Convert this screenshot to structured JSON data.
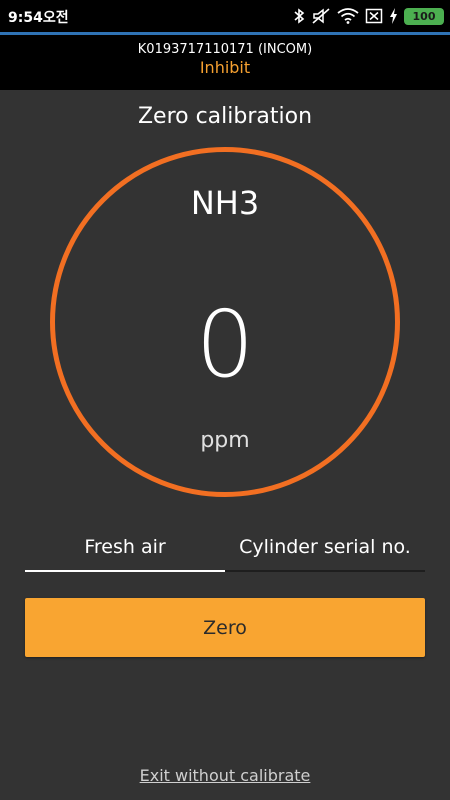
{
  "status_bar": {
    "time": "9:54오전",
    "icons": [
      "bluetooth-icon",
      "mute-icon",
      "wifi-icon",
      "sim-x-icon",
      "charging-icon"
    ],
    "battery_label": "100"
  },
  "header": {
    "device_id": "K0193717110171 (INCOM)",
    "device_status": "Inhibit"
  },
  "page": {
    "title": "Zero calibration"
  },
  "gauge": {
    "gas_name": "NH3",
    "reading": "0",
    "unit": "ppm"
  },
  "tabs": [
    {
      "label": "Fresh air",
      "selected": true
    },
    {
      "label": "Cylinder serial no.",
      "selected": false
    }
  ],
  "actions": {
    "zero_label": "Zero",
    "exit_label": "Exit without calibrate"
  },
  "colors": {
    "accent_orange": "#f26f22",
    "button_orange": "#f9a531",
    "status_text": "#f5a030",
    "background": "#333333"
  }
}
